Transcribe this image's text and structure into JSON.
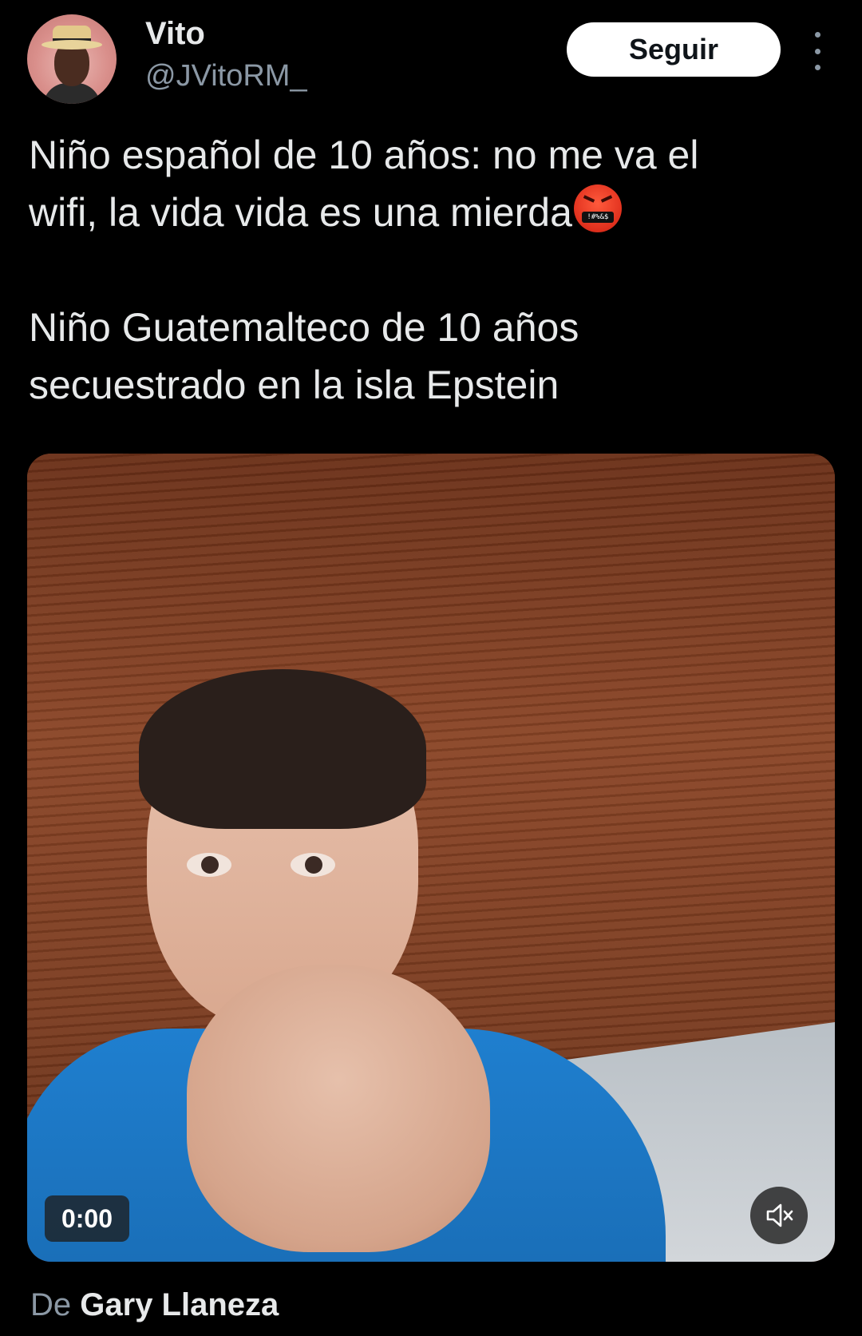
{
  "user": {
    "display_name": "Vito",
    "handle": "@JVitoRM_",
    "avatar_icon": "profile-photo"
  },
  "follow_button": {
    "label": "Seguir"
  },
  "more_menu": {
    "icon": "more-vertical-icon"
  },
  "tweet": {
    "paragraph_1_line_1": "Niño español de 10 años: no me va el",
    "paragraph_1_line_2": "wifi, la vida vida es una mierda",
    "paragraph_1_emoji": "face-with-symbols-on-mouth",
    "emoji_mouth_symbols": "!#%&$",
    "paragraph_2_line_1": "Niño Guatemalteco de 10 años",
    "paragraph_2_line_2": "secuestrado en la isla Epstein"
  },
  "video": {
    "time": "0:00",
    "mute_icon": "muted-speaker-icon"
  },
  "attribution": {
    "prefix": "De",
    "author": "Gary Llaneza"
  },
  "colors": {
    "background": "#000000",
    "primary_text": "#e7e9ea",
    "secondary_text": "#8b98a5",
    "follow_bg": "#ffffff"
  }
}
